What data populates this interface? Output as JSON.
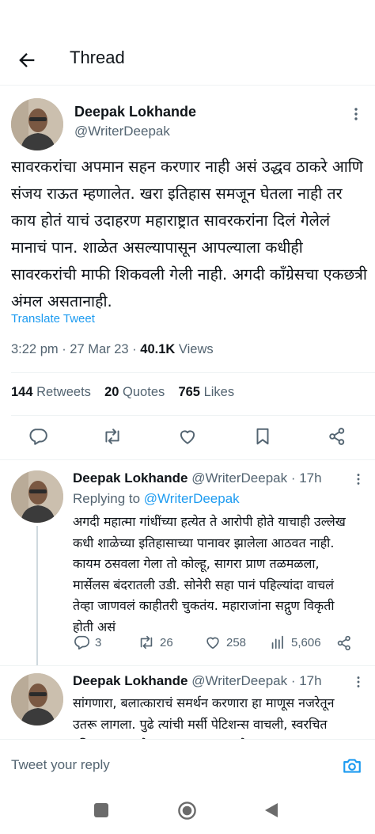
{
  "header": {
    "title": "Thread",
    "back_icon": "arrow-left-icon"
  },
  "tweet": {
    "name": "Deepak Lokhande",
    "handle": "@WriterDeepak",
    "text": "सावरकरांचा अपमान सहन करणार नाही असं उद्धव ठाकरे आणि संजय राऊत म्हणालेत. खरा इतिहास समजून घेतला नाही तर काय होतं याचं उदाहरण महाराष्ट्रात सावरकरांना दिलं गेलेलं मानाचं पान. शाळेत असल्यापासून आपल्याला कधीही सावरकरांची माफी शिकवली गेली नाही. अगदी काँग्रेसचा एकछत्री अंमल असतानाही.",
    "translate": "Translate Tweet",
    "time": "3:22 pm",
    "date": "27 Mar 23",
    "views_count": "40.1K",
    "views_label": "Views",
    "retweets_count": "144",
    "retweets_label": "Retweets",
    "quotes_count": "20",
    "quotes_label": "Quotes",
    "likes_count": "765",
    "likes_label": "Likes"
  },
  "replies": [
    {
      "name": "Deepak Lokhande",
      "handle": "@WriterDeepak",
      "age": "17h",
      "replying_label": "Replying to",
      "replying_to": "@WriterDeepak",
      "text": "अगदी महात्मा गांधींच्या हत्येत ते आरोपी होते याचाही उल्लेख कधी शाळेच्या इतिहासाच्या पानावर झालेला आठवत नाही. कायम ठसवला गेला तो कोल्हू, सागरा प्राण तळमळला, मार्सेलस बंदरातली उडी. सोनेरी सहा पानं पहिल्यांदा वाचलं तेव्हा जाणवलं काहीतरी चुकतंय. महाराजांना सद्गुण विकृती होती असं",
      "replies": "3",
      "retweets": "26",
      "likes": "258",
      "views": "5,606"
    },
    {
      "name": "Deepak Lokhande",
      "handle": "@WriterDeepak",
      "age": "17h",
      "text": "सांगणारा, बलात्काराचं समर्थन करणारा हा माणूस नजरेतून उतरू लागला. पुढे त्यांची मर्सी पेटिशन्स वाचली, स्वरचित इतिहासातला फोलपणा कळला तसतसे सावरकर दरावत"
    }
  ],
  "reply_bar": {
    "placeholder": "Tweet your reply"
  },
  "colors": {
    "accent": "#1d9bf0",
    "text": "#0f1419",
    "muted": "#536471"
  }
}
